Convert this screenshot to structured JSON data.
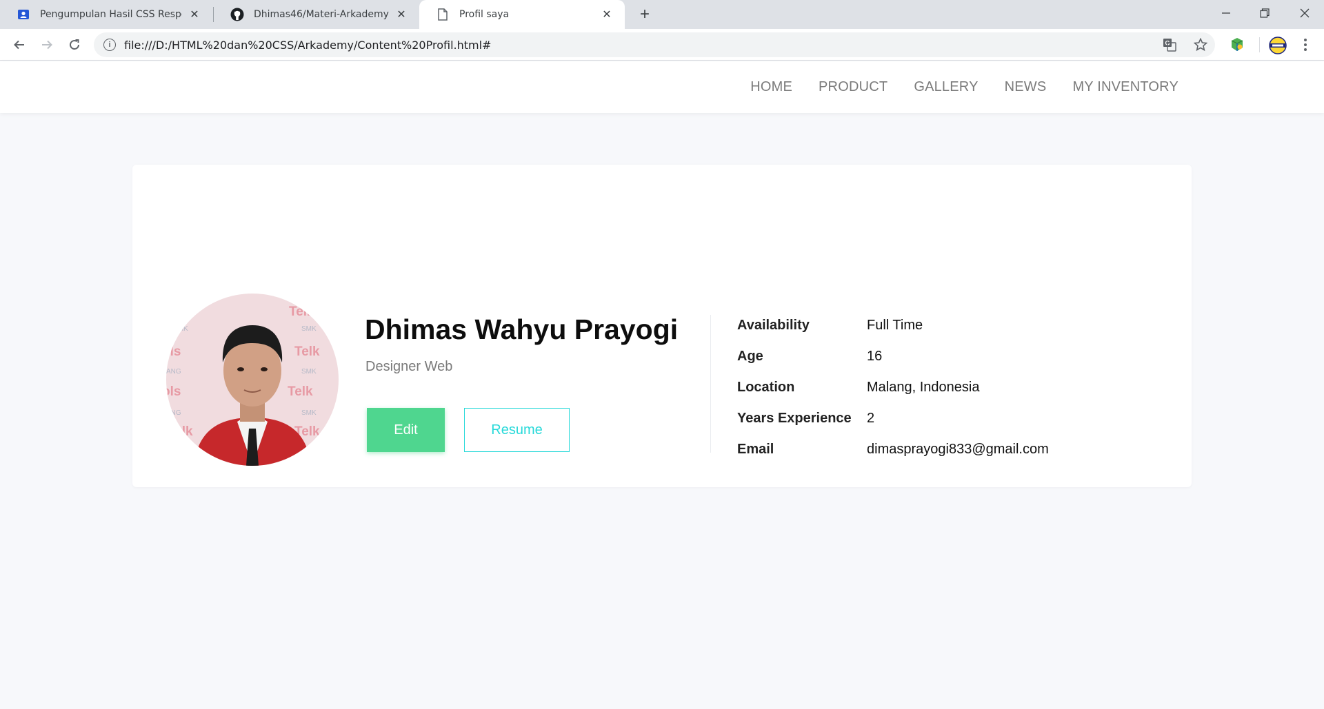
{
  "browser": {
    "tabs": [
      {
        "title": "Pengumpulan Hasil CSS Responsi"
      },
      {
        "title": "Dhimas46/Materi-Arkademy"
      },
      {
        "title": "Profil saya"
      }
    ],
    "url": "file:///D:/HTML%20dan%20CSS/Arkademy/Content%20Profil.html#"
  },
  "nav": {
    "items": [
      "HOME",
      "PRODUCT",
      "GALLERY",
      "NEWS",
      "MY INVENTORY"
    ]
  },
  "profile": {
    "name": "Dhimas Wahyu Prayogi",
    "role": "Designer Web",
    "edit_label": "Edit",
    "resume_label": "Resume",
    "details": [
      {
        "label": "Availability",
        "value": "Full Time"
      },
      {
        "label": "Age",
        "value": "16"
      },
      {
        "label": "Location",
        "value": "Malang, Indonesia"
      },
      {
        "label": "Years Experience",
        "value": "2"
      },
      {
        "label": "Email",
        "value": "dimasprayogi833@gmail.com"
      }
    ]
  },
  "colors": {
    "accent_green": "#4fd68f",
    "accent_cyan": "#27d9d9",
    "page_bg": "#f7f8fb"
  }
}
